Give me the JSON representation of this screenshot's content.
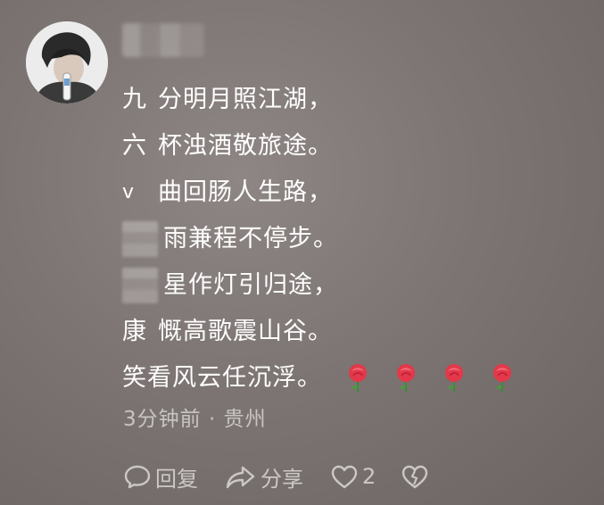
{
  "comment": {
    "avatar_icon": "avatar-photo",
    "lines": [
      {
        "head": "九",
        "text": "分明月照江湖，"
      },
      {
        "head": "六",
        "text": "杯浊酒敬旅途。"
      },
      {
        "head": "v",
        "text": "曲回肠人生路，"
      },
      {
        "head": "",
        "text": "雨兼程不停步。"
      },
      {
        "head": "",
        "text": "星作灯引归途，"
      },
      {
        "head": "康",
        "text": "慨高歌震山谷。"
      },
      {
        "head": "",
        "text": "笑看风云任沉浮。"
      }
    ],
    "emoji_icon": "rose-icon",
    "time": "3分钟前",
    "separator": "·",
    "location": "贵州"
  },
  "actions": {
    "reply_label": "回复",
    "share_label": "分享",
    "like_count": "2"
  },
  "colors": {
    "background": "#7d7573",
    "text": "#ffffff",
    "muted": "#c8c2c0",
    "rose": "#e2384a"
  }
}
